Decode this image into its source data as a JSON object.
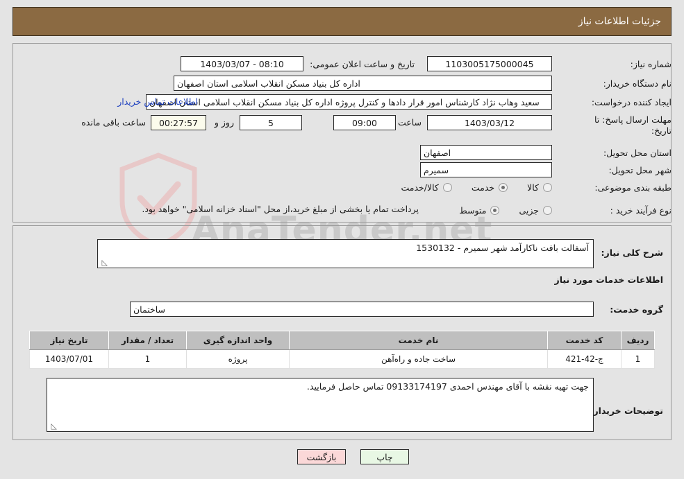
{
  "header": {
    "title": "جزئیات اطلاعات نیاز"
  },
  "form": {
    "need_number_label": "شماره نیاز:",
    "need_number_value": "1103005175000045",
    "public_announce_label": "تاریخ و ساعت اعلان عمومی:",
    "public_announce_value": "08:10 - 1403/03/07",
    "buyer_org_label": "نام دستگاه خریدار:",
    "buyer_org_value": "اداره کل بنیاد مسکن انقلاب اسلامی استان اصفهان",
    "requester_label": "ایجاد کننده درخواست:",
    "requester_value": "سعید وهاب نژاد کارشناس امور قرار دادها و کنترل  پروژه اداره کل بنیاد مسکن انقلاب اسلامی استان اصفهان",
    "contact_link": "اطلاعات تماس خریدار",
    "deadline_label": "مهلت ارسال پاسخ: تا تاریخ:",
    "deadline_date": "1403/03/12",
    "hour_label": "ساعت",
    "deadline_hour": "09:00",
    "days_remaining": "5",
    "days_word": "روز و",
    "countdown": "00:27:57",
    "hours_remaining_label": "ساعت باقی مانده",
    "province_label": "استان محل تحویل:",
    "province_value": "اصفهان",
    "city_label": "شهر محل تحویل:",
    "city_value": "سمیرم",
    "category_label": "طبقه بندی موضوعی:",
    "category_options": [
      {
        "label": "کالا",
        "selected": false
      },
      {
        "label": "خدمت",
        "selected": true
      },
      {
        "label": "کالا/خدمت",
        "selected": false
      }
    ],
    "process_label": "نوع فرآیند خرید :",
    "process_options": [
      {
        "label": "جزیی",
        "selected": false
      },
      {
        "label": "متوسط",
        "selected": true
      }
    ],
    "process_note": "پرداخت تمام یا بخشی از مبلغ خرید،از محل \"اسناد خزانه اسلامی\" خواهد بود."
  },
  "description": {
    "label": "شرح کلی نیاز:",
    "value": "آسفالت بافت ناکارآمد شهر سمیرم - 1530132"
  },
  "services_section": {
    "title": "اطلاعات خدمات مورد نیاز",
    "group_label": "گروه خدمت:",
    "group_value": "ساختمان"
  },
  "table": {
    "headers": [
      "ردیف",
      "کد خدمت",
      "نام خدمت",
      "واحد اندازه گیری",
      "تعداد / مقدار",
      "تاریخ نیاز"
    ],
    "rows": [
      {
        "radif": "1",
        "code": "ج-42-421",
        "name": "ساخت جاده و راه‌آهن",
        "unit": "پروژه",
        "qty": "1",
        "date": "1403/07/01"
      }
    ]
  },
  "buyer_notes": {
    "label": "توضیحات خریدار:",
    "value": "جهت تهیه نقشه با آقای مهندس احمدی 09133174197 تماس حاصل فرمایید."
  },
  "footer": {
    "print_label": "چاپ",
    "back_label": "بازگشت"
  },
  "watermark": {
    "text": "AnaTender.net"
  },
  "colors": {
    "header_bg": "#8b6a42",
    "table_header_bg": "#bfbfbf",
    "link": "#1c3fbf",
    "print_btn": "#e8f7e4",
    "back_btn": "#fbd8d8",
    "countdown_bg": "#fbfbec"
  }
}
